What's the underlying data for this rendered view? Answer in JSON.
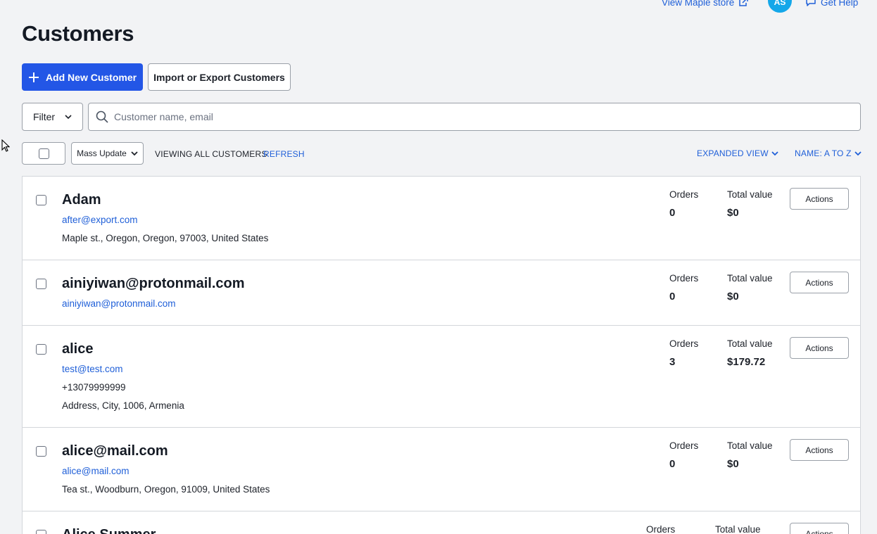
{
  "header": {
    "store_link": "View Maple store",
    "avatar_initials": "AS",
    "help_link": "Get Help"
  },
  "page": {
    "title": "Customers"
  },
  "toolbar": {
    "add_label": "Add New Customer",
    "import_label": "Import or Export Customers",
    "filter_label": "Filter",
    "search_placeholder": "Customer name, email",
    "search_value": "",
    "mass_update_label": "Mass Update",
    "viewing_label": "VIEWING ALL CUSTOMERS",
    "refresh_label": "REFRESH",
    "view_mode_label": "EXPANDED VIEW",
    "sort_label": "NAME: A TO Z"
  },
  "customers": [
    {
      "name": "Adam",
      "email": "after@export.com",
      "line1": "Maple st., Oregon, Oregon, 97003, United States",
      "line2": "",
      "orders_label": "Orders",
      "orders": "0",
      "total_label": "Total value",
      "total": "$0",
      "actions_label": "Actions"
    },
    {
      "name": "ainiyiwan@protonmail.com",
      "email": "ainiyiwan@protonmail.com",
      "line1": "",
      "line2": "",
      "orders_label": "Orders",
      "orders": "0",
      "total_label": "Total value",
      "total": "$0",
      "actions_label": "Actions"
    },
    {
      "name": "alice",
      "email": "test@test.com",
      "line1": "+13079999999",
      "line2": "Address, City, 1006, Armenia",
      "orders_label": "Orders",
      "orders": "3",
      "total_label": "Total value",
      "total": "$179.72",
      "actions_label": "Actions"
    },
    {
      "name": "alice@mail.com",
      "email": "alice@mail.com",
      "line1": "Tea st., Woodburn, Oregon, 91009, United States",
      "line2": "",
      "orders_label": "Orders",
      "orders": "0",
      "total_label": "Total value",
      "total": "$0",
      "actions_label": "Actions"
    },
    {
      "name": "Alice Summer",
      "email": "",
      "line1": "",
      "line2": "",
      "orders_label": "Orders",
      "orders": "",
      "total_label": "Total value",
      "total": "",
      "actions_label": "Actions"
    }
  ],
  "colors": {
    "accent": "#2356e6",
    "link": "#1f5fd8",
    "avatar": "#14a7e9",
    "background": "#f2f3f5"
  },
  "icons": {
    "store_link": "external-link-icon",
    "help_link": "chat-bubble-icon",
    "add": "plus-icon",
    "filter": "chevron-down-icon",
    "search": "search-icon",
    "mass_update": "chevron-down-icon",
    "view_mode": "chevron-down-icon",
    "sort": "chevron-down-icon",
    "cursor": "mouse-pointer-icon"
  }
}
